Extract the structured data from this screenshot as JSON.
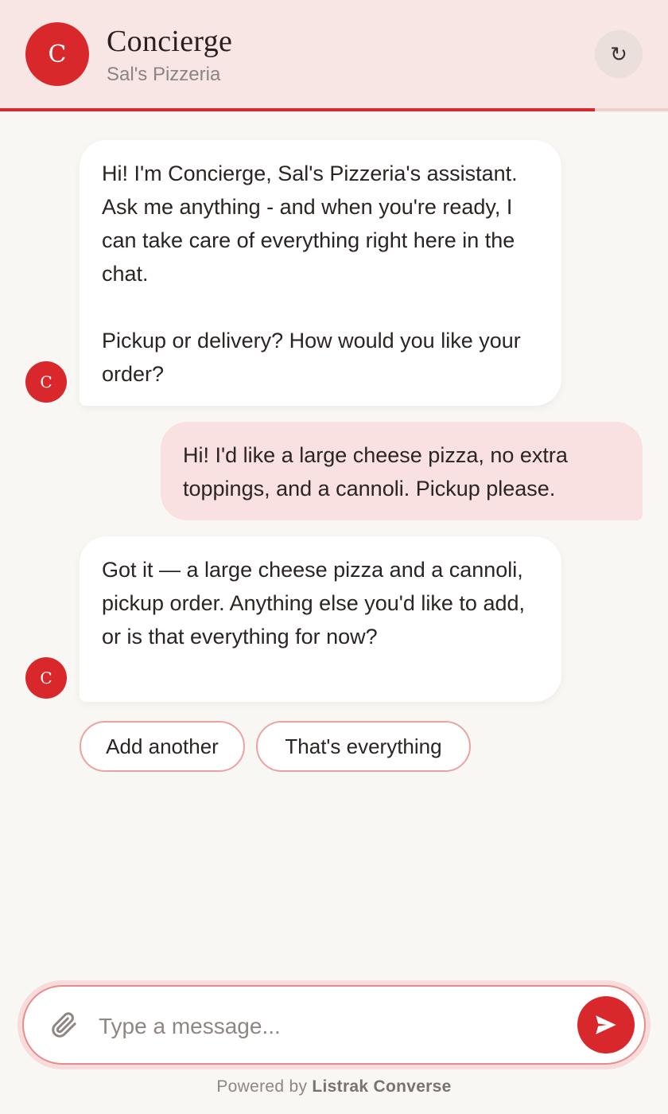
{
  "header": {
    "avatar_letter": "C",
    "title": "Concierge",
    "subtitle": "Sal's Pizzeria",
    "refresh_icon": "refresh-icon",
    "refresh_glyph": "↻",
    "progress_fraction": 0.89
  },
  "messages": [
    {
      "role": "bot",
      "avatar_letter": "C",
      "text": "Hi! I'm Concierge, Sal's Pizzeria's assistant. Ask me anything - and when you're ready, I can take care of everything right here in the chat.\n\nPickup or delivery? How would you like your order?"
    },
    {
      "role": "user",
      "text": "Hi! I'd like a large cheese pizza, no extra toppings, and a cannoli. Pickup please."
    },
    {
      "role": "bot",
      "avatar_letter": "C",
      "text": "Got it — a large cheese pizza and a cannoli, pickup order. Anything else you'd like to add, or is that everything for now?"
    }
  ],
  "quick_replies": [
    "Add another",
    "That's everything"
  ],
  "composer": {
    "placeholder": "Type a message...",
    "attach_icon": "paperclip-icon",
    "send_icon": "send-icon"
  },
  "footer": {
    "prefix": "Powered by",
    "brand": "Listrak Converse"
  },
  "colors": {
    "accent": "#d9282c",
    "header_bg": "#f8e6e4",
    "user_bubble": "#f8e1e0",
    "page_bg": "#f9f7f3"
  }
}
